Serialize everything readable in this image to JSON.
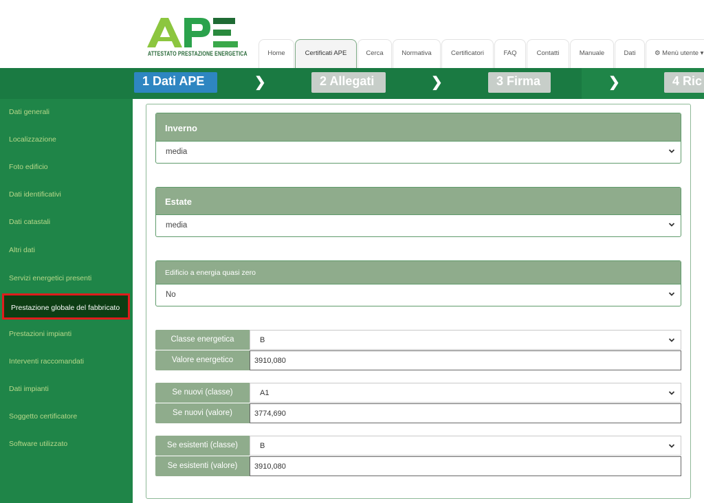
{
  "header": {
    "logo_text": "APE",
    "logo_subtitle": "ATTESTATO PRESTAZIONE ENERGETICA",
    "tabs": [
      {
        "label": "Home"
      },
      {
        "label": "Certificati APE"
      },
      {
        "label": "Cerca"
      },
      {
        "label": "Normativa"
      },
      {
        "label": "Certificatori"
      },
      {
        "label": "FAQ"
      },
      {
        "label": "Contatti"
      },
      {
        "label": "Manuale"
      },
      {
        "label": "Dati"
      },
      {
        "label": "Menù utente"
      }
    ]
  },
  "steps": [
    {
      "label": "1 Dati APE"
    },
    {
      "label": "2 Allegati"
    },
    {
      "label": "3 Firma"
    },
    {
      "label": "4 Ric"
    }
  ],
  "sidebar": {
    "items": [
      {
        "label": "Dati generali"
      },
      {
        "label": "Localizzazione"
      },
      {
        "label": "Foto edificio"
      },
      {
        "label": "Dati identificativi"
      },
      {
        "label": "Dati catastali"
      },
      {
        "label": "Altri dati"
      },
      {
        "label": "Servizi energetici presenti"
      },
      {
        "label": "Prestazione globale del fabbricato"
      },
      {
        "label": "Prestazioni impianti"
      },
      {
        "label": "Interventi raccomandati"
      },
      {
        "label": "Dati impianti"
      },
      {
        "label": "Soggetto certificatore"
      },
      {
        "label": "Software utilizzato"
      }
    ]
  },
  "form": {
    "inverno": {
      "title": "Inverno",
      "value": "media"
    },
    "estate": {
      "title": "Estate",
      "value": "media"
    },
    "nzeb": {
      "title": "Edificio a energia quasi zero",
      "value": "No"
    },
    "classe_energetica": {
      "label": "Classe energetica",
      "value": "B"
    },
    "valore_energetico": {
      "label": "Valore energetico",
      "value": "3910,080"
    },
    "nuovi_classe": {
      "label": "Se nuovi (classe)",
      "value": "A1"
    },
    "nuovi_valore": {
      "label": "Se nuovi (valore)",
      "value": "3774,690"
    },
    "esistenti_classe": {
      "label": "Se esistenti (classe)",
      "value": "B"
    },
    "esistenti_valore": {
      "label": "Se esistenti (valore)",
      "value": "3910,080"
    }
  },
  "colors": {
    "brand_green": "#1f8548",
    "logo_light_green": "#8cc63f",
    "active_step": "#2e86c1",
    "highlight_border": "#e01c1c",
    "panel_header": "#8fac8c"
  }
}
